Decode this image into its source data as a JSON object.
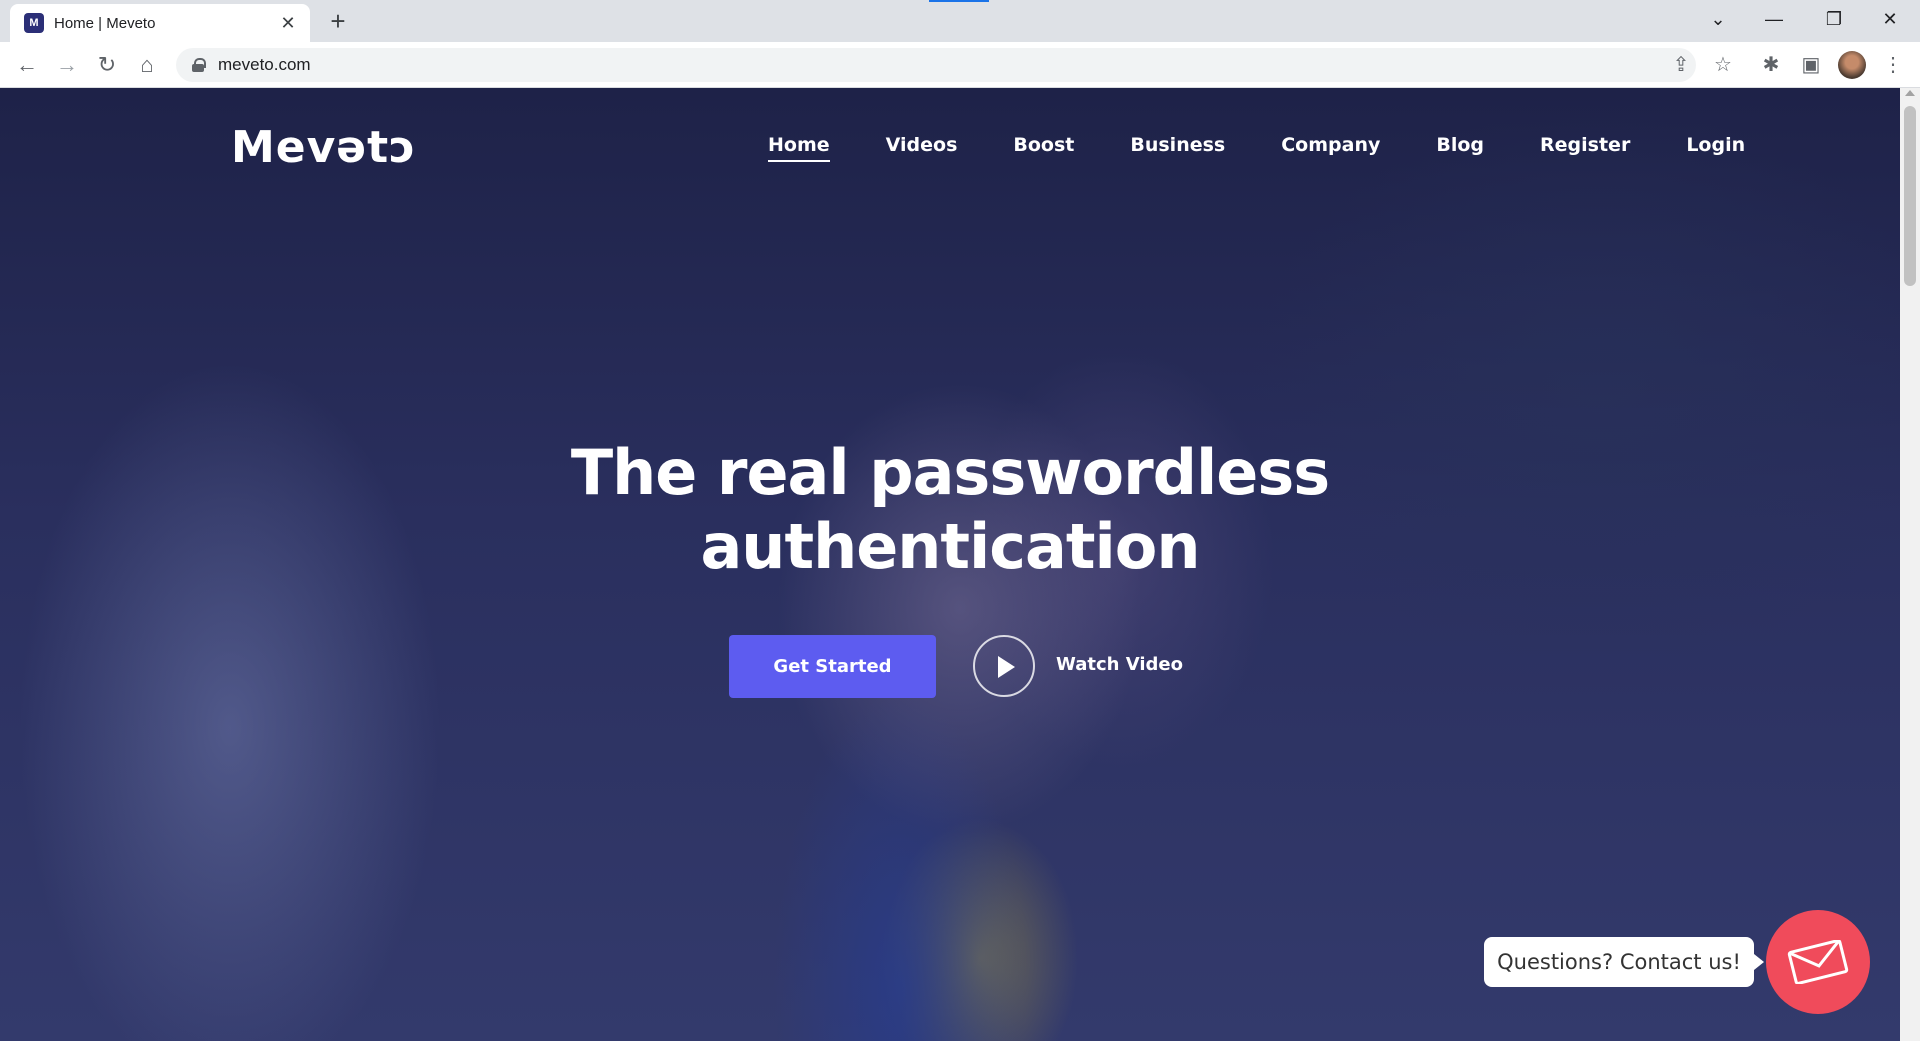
{
  "browser": {
    "tab_title": "Home | Meveto",
    "tab_close": "✕",
    "new_tab": "+",
    "url": "meveto.com",
    "window_controls": {
      "dropdown": "⌄",
      "minimize": "—",
      "restore": "❐",
      "close": "✕"
    }
  },
  "site": {
    "logo": "Mevǝtɔ",
    "nav": [
      {
        "label": "Home",
        "active": true
      },
      {
        "label": "Videos"
      },
      {
        "label": "Boost"
      },
      {
        "label": "Business"
      },
      {
        "label": "Company"
      },
      {
        "label": "Blog"
      },
      {
        "label": "Register"
      },
      {
        "label": "Login"
      }
    ],
    "hero": {
      "title_pre": "The ",
      "title_bold": "real",
      "title_post": " passwordless",
      "title_line2": "authentication"
    },
    "cta_primary": "Get Started",
    "cta_secondary": "Watch Video",
    "contact_bubble": "Questions? Contact us!"
  },
  "icons": [
    "back-icon",
    "forward-icon",
    "reload-icon",
    "home-icon",
    "lock-icon",
    "share-icon",
    "star-icon",
    "extensions-icon",
    "sidebar-icon",
    "menu-icon",
    "play-icon",
    "envelope-icon"
  ],
  "colors": {
    "accent": "#5d5cf0",
    "contact": "#f04b5b"
  }
}
